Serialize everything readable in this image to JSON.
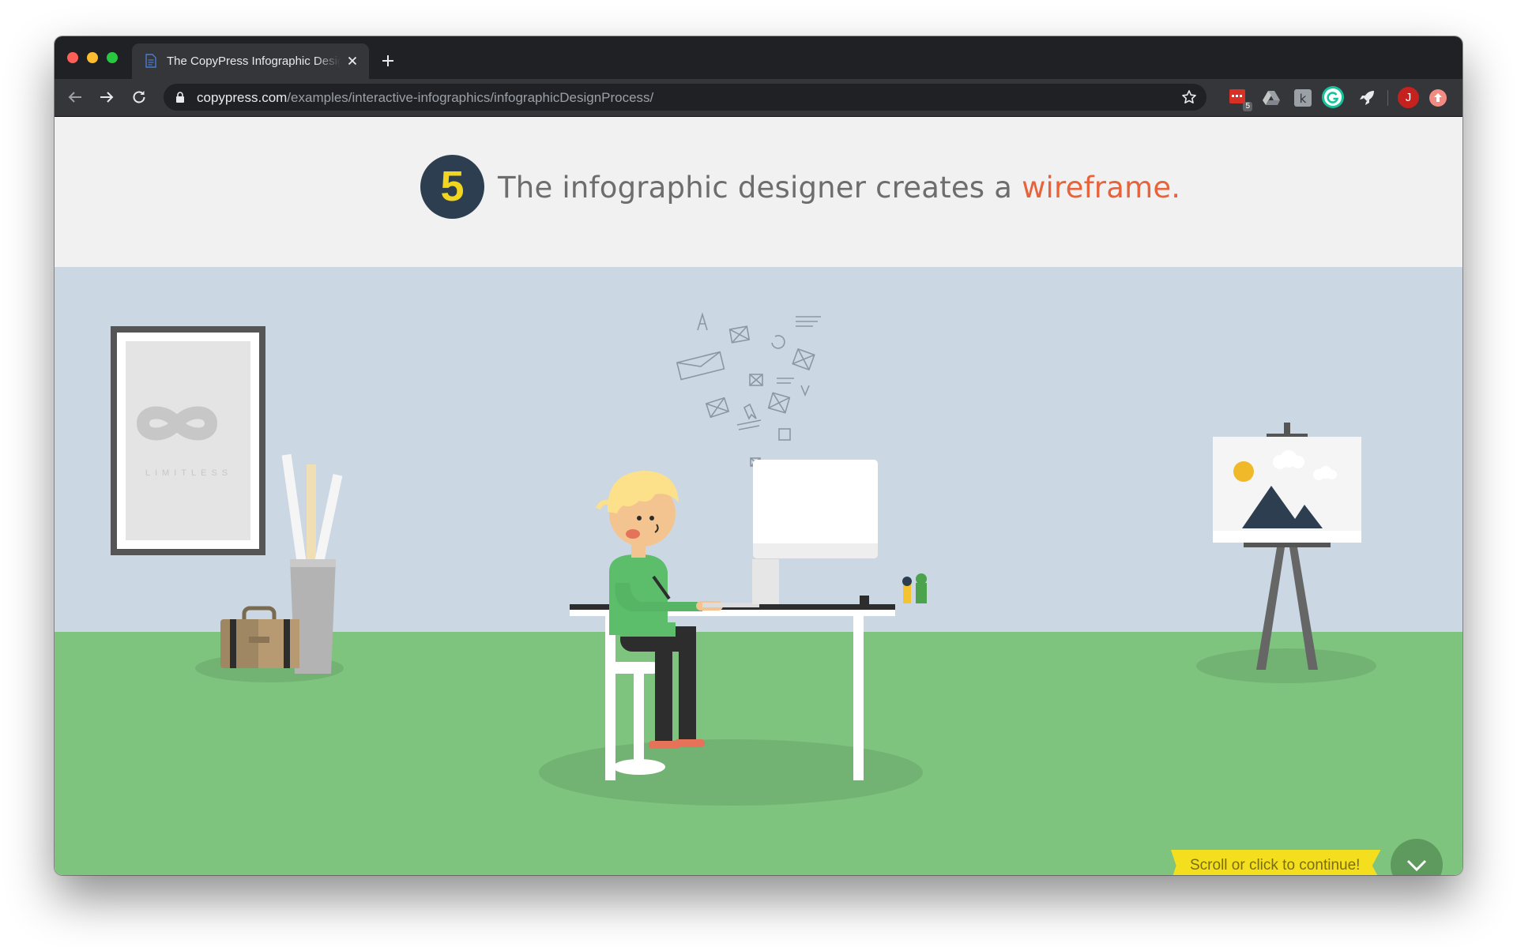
{
  "browser": {
    "tab_title": "The CopyPress Infographic Design Process",
    "url_host": "copypress.com",
    "url_path": "/examples/interactive-infographics/infographicDesignProcess/",
    "extension_badge": "5",
    "profile_initial": "J"
  },
  "page": {
    "step_number": "5",
    "headline_prefix": "The infographic designer creates a ",
    "headline_accent": "wireframe.",
    "poster_text": "LIMITLESS",
    "continue_label": "Scroll or click to continue!"
  },
  "colors": {
    "accent": "#e8633b",
    "step_circle": "#2c3e50",
    "step_number": "#f2d51e",
    "wall": "#cbd8e3",
    "floor": "#7fc47e",
    "banner": "#f4df1e"
  },
  "icons": [
    "back-arrow-icon",
    "forward-arrow-icon",
    "reload-icon",
    "lock-icon",
    "star-icon",
    "close-icon",
    "plus-icon",
    "chevron-down-icon"
  ]
}
